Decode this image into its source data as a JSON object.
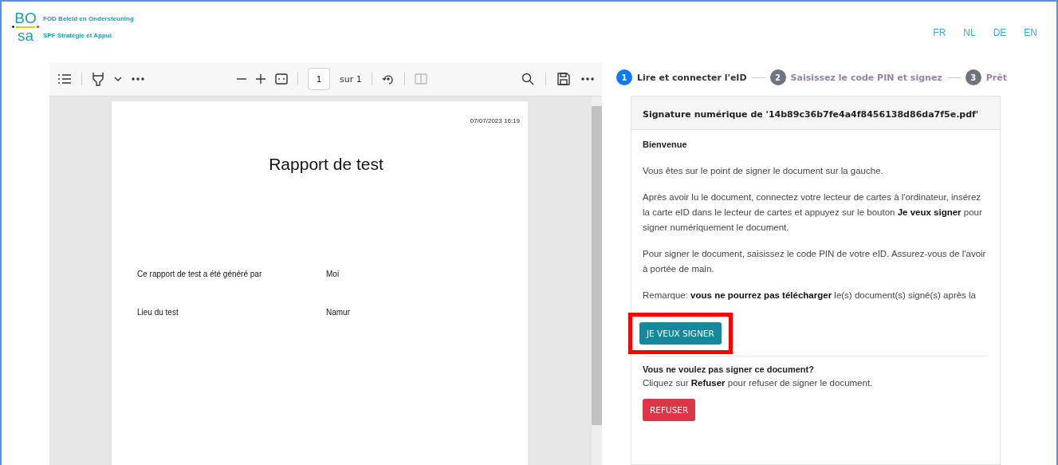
{
  "header": {
    "logo": {
      "top": "BO",
      "bottom": "sa"
    },
    "org_names": [
      "FOD Beleid en Ondersteuning",
      "SPF Stratégie et Appui"
    ],
    "languages": [
      "FR",
      "NL",
      "DE",
      "EN"
    ]
  },
  "viewer": {
    "page": "1",
    "page_total": "sur 1",
    "document": {
      "date": "07/07/2023 16:19",
      "title": "Rapport de test",
      "fields": [
        {
          "label": "Ce rapport de test a été généré par",
          "value": "Moi"
        },
        {
          "label": "Lieu du test",
          "value": "Namur"
        }
      ]
    }
  },
  "steps": [
    {
      "number": "1",
      "label": "Lire et connecter l'eID",
      "active": true
    },
    {
      "number": "2",
      "label": "Saisissez le code PIN et signez",
      "active": false
    },
    {
      "number": "3",
      "label": "Prêt",
      "active": false
    }
  ],
  "card": {
    "title": "Signature numérique de '14b89c36b7fe4a4f8456138d86da7f5e.pdf'",
    "heading": "Bienvenue",
    "paragraphs": [
      "Vous êtes sur le point de signer le document sur la gauche.",
      "Après avoir lu le document, connectez votre lecteur de cartes à l'ordinateur, insérez la carte eID dans le lecteur de cartes et appuyez sur le bouton **Je veux signer** pour signer numériquement le document.",
      "Pour signer le document, saisissez le code PIN de votre eID. Assurez-vous de l'avoir à portée de main.",
      "Remarque: **vous ne pourrez pas télécharger** le(s) document(s) signé(s) après la"
    ],
    "sign_button": {
      "label": "JE VEUX SIGNER",
      "highlighted": true
    },
    "decline_heading": "Vous ne voulez pas signer ce document?",
    "decline_text": "Cliquez sur **Refuser** pour refuser de signer le document.",
    "refuse_button": "REFUSER"
  }
}
